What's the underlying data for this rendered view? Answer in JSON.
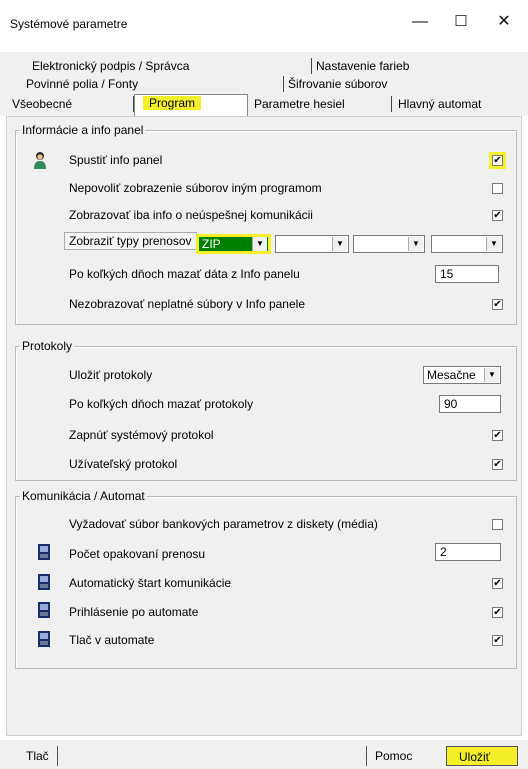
{
  "window": {
    "title": "Systémové parametre",
    "minimize": "—",
    "maximize": "☐",
    "close": "✕"
  },
  "tabs": {
    "row1": [
      "Elektronický podpis / Správca",
      "Nastavenie farieb"
    ],
    "row2": [
      "Povinné polia / Fonty",
      "Šifrovanie súborov"
    ],
    "row3": [
      "Všeobecné",
      "Program",
      "Parametre hesiel",
      "Hlavný automat"
    ]
  },
  "info_panel": {
    "legend": "Informácie a info panel",
    "spustit": {
      "label": "Spustiť info panel",
      "checked": "✔"
    },
    "nepovolit": {
      "label": "Nepovoliť zobrazenie súborov iným programom",
      "checked": ""
    },
    "zobrazovat": {
      "label": "Zobrazovať iba info o neúspešnej komunikácii",
      "checked": "✔"
    },
    "typy": {
      "label": "Zobraziť typy prenosov",
      "values": [
        "ZIP",
        "",
        "",
        ""
      ]
    },
    "dni": {
      "label": "Po koľkých dňoch mazať dáta z Info panelu",
      "value": "15"
    },
    "neplatne": {
      "label": "Nezobrazovať neplatné súbory v Info panele",
      "checked": "✔"
    }
  },
  "protokoly": {
    "legend": "Protokoly",
    "ulozit": {
      "label": "Uložiť protokoly",
      "value": "Mesačne"
    },
    "dni": {
      "label": "Po koľkých dňoch mazať protokoly",
      "value": "90"
    },
    "systemovy": {
      "label": "Zapnúť systémový protokol",
      "checked": "✔"
    },
    "uzivatelsky": {
      "label": "Užívateľský protokol",
      "checked": "✔"
    }
  },
  "komunikacia": {
    "legend": "Komunikácia / Automat",
    "vyzadovat": {
      "label": "Vyžadovať súbor bankových parametrov z diskety (média)",
      "checked": ""
    },
    "pocet": {
      "label": "Počet opakovaní prenosu",
      "value": "2"
    },
    "start": {
      "label": "Automatický štart komunikácie",
      "checked": "✔"
    },
    "prihlasenie": {
      "label": "Prihlásenie po automate",
      "checked": "✔"
    },
    "tlac": {
      "label": "Tlač v automate",
      "checked": "✔"
    }
  },
  "buttons": {
    "print": "Tlač",
    "help": "Pomoc",
    "save": "Uložiť"
  },
  "colors": {
    "highlight": "#f5ef2a",
    "zip_bg": "#008000"
  }
}
